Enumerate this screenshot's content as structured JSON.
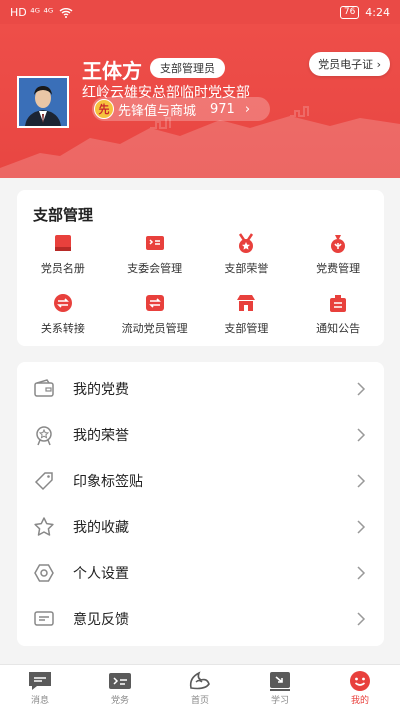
{
  "statusbar": {
    "left": "HD ⁴ᴳ ⁴ᴳ",
    "battery": "76",
    "time": "4:24"
  },
  "profile": {
    "name": "王体方",
    "role_badge": "支部管理员",
    "branch": "红岭云雄安总部临时党支部",
    "shop_coin": "先",
    "shop_label": "先锋值与商城",
    "shop_points": "971",
    "e_cert_label": "党员电子证"
  },
  "management": {
    "title": "支部管理",
    "items": [
      {
        "label": "党员名册",
        "icon": "book-icon"
      },
      {
        "label": "支委会管理",
        "icon": "flag-icon"
      },
      {
        "label": "支部荣誉",
        "icon": "medal-icon"
      },
      {
        "label": "党费管理",
        "icon": "money-bag-icon"
      },
      {
        "label": "关系转接",
        "icon": "transfer-icon"
      },
      {
        "label": "流动党员管理",
        "icon": "exchange-icon"
      },
      {
        "label": "支部管理",
        "icon": "store-icon"
      },
      {
        "label": "通知公告",
        "icon": "notice-icon"
      }
    ]
  },
  "menu": [
    {
      "label": "我的党费",
      "icon": "wallet-icon"
    },
    {
      "label": "我的荣誉",
      "icon": "honor-icon"
    },
    {
      "label": "印象标签贴",
      "icon": "tag-icon"
    },
    {
      "label": "我的收藏",
      "icon": "star-icon"
    },
    {
      "label": "个人设置",
      "icon": "settings-icon"
    },
    {
      "label": "意见反馈",
      "icon": "feedback-icon"
    }
  ],
  "tabbar": [
    {
      "label": "消息",
      "icon": "message-icon"
    },
    {
      "label": "党务",
      "icon": "party-affairs-icon"
    },
    {
      "label": "首页",
      "icon": "home-icon"
    },
    {
      "label": "学习",
      "icon": "study-icon"
    },
    {
      "label": "我的",
      "icon": "profile-icon"
    }
  ],
  "colors": {
    "brand": "#e8403c",
    "header": "#ea4a46",
    "coin": "#f6c23e"
  }
}
